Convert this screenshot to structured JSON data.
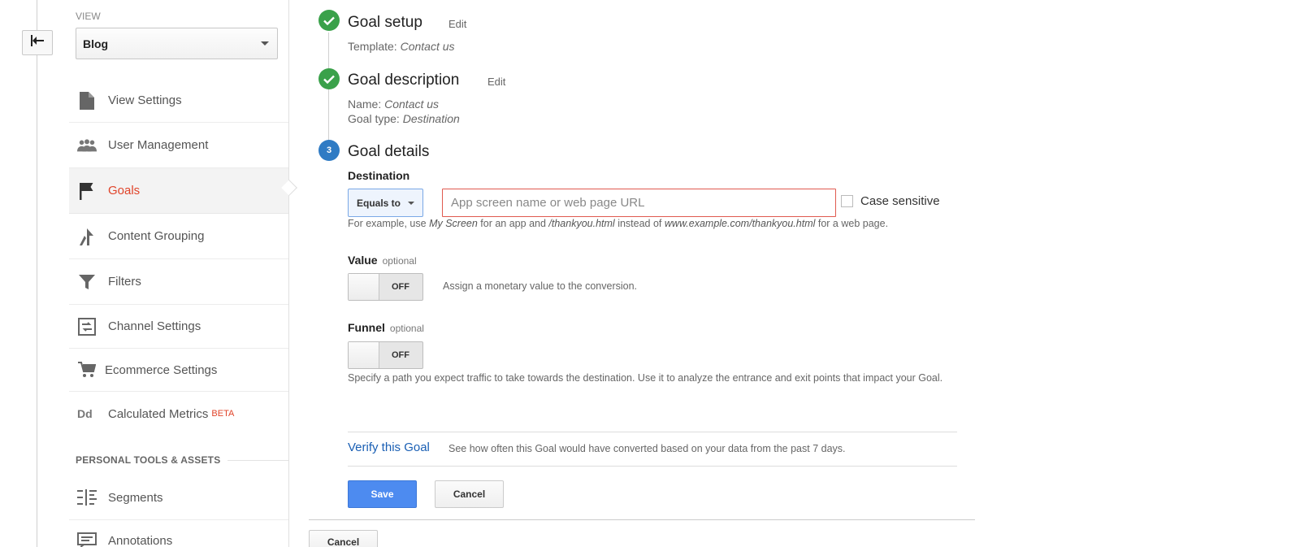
{
  "sidebar": {
    "view_label": "VIEW",
    "view_selected": "Blog",
    "items": [
      {
        "label": "View Settings",
        "icon": "document-icon"
      },
      {
        "label": "User Management",
        "icon": "users-icon"
      },
      {
        "label": "Goals",
        "icon": "flag-icon",
        "active": true
      },
      {
        "label": "Content Grouping",
        "icon": "content-grouping-icon"
      },
      {
        "label": "Filters",
        "icon": "filter-icon"
      },
      {
        "label": "Channel Settings",
        "icon": "channel-settings-icon"
      },
      {
        "label": "Ecommerce Settings",
        "icon": "cart-icon"
      },
      {
        "label": "Calculated Metrics",
        "icon": "calculated-metrics-icon",
        "badge": "BETA"
      }
    ],
    "section_title": "PERSONAL TOOLS & ASSETS",
    "personal_items": [
      {
        "label": "Segments",
        "icon": "segments-icon"
      },
      {
        "label": "Annotations",
        "icon": "annotations-icon"
      }
    ]
  },
  "steps": {
    "setup": {
      "title": "Goal setup",
      "edit": "Edit",
      "template_label": "Template:",
      "template_value": "Contact us"
    },
    "description": {
      "title": "Goal description",
      "edit": "Edit",
      "name_label": "Name:",
      "name_value": "Contact us",
      "type_label": "Goal type:",
      "type_value": "Destination"
    },
    "details": {
      "number": "3",
      "title": "Goal details"
    }
  },
  "destination": {
    "label": "Destination",
    "match_type": "Equals to",
    "input_value": "",
    "input_placeholder": "App screen name or web page URL",
    "case_sensitive_label": "Case sensitive",
    "case_sensitive_checked": false,
    "help": {
      "p1": "For example, use",
      "ex1": "My Screen",
      "p2": "for an app and",
      "ex2": "/thankyou.html",
      "p3": "instead of",
      "ex3": "www.example.com/thankyou.html",
      "p4": "for a web page."
    }
  },
  "value": {
    "label": "Value",
    "optional": "optional",
    "toggle_state": "OFF",
    "description": "Assign a monetary value to the conversion."
  },
  "funnel": {
    "label": "Funnel",
    "optional": "optional",
    "toggle_state": "OFF",
    "description": "Specify a path you expect traffic to take towards the destination. Use it to analyze the entrance and exit points that impact your Goal."
  },
  "verify": {
    "link": "Verify this Goal",
    "description": "See how often this Goal would have converted based on your data from the past 7 days."
  },
  "actions": {
    "save": "Save",
    "cancel": "Cancel",
    "outer_cancel": "Cancel"
  },
  "colors": {
    "active_nav": "#e0442a",
    "done_badge": "#3aa14a",
    "step_badge": "#2f7bc4",
    "save_button": "#4d8bf0",
    "link": "#1a5fb4",
    "error_border": "#e05a4f"
  }
}
